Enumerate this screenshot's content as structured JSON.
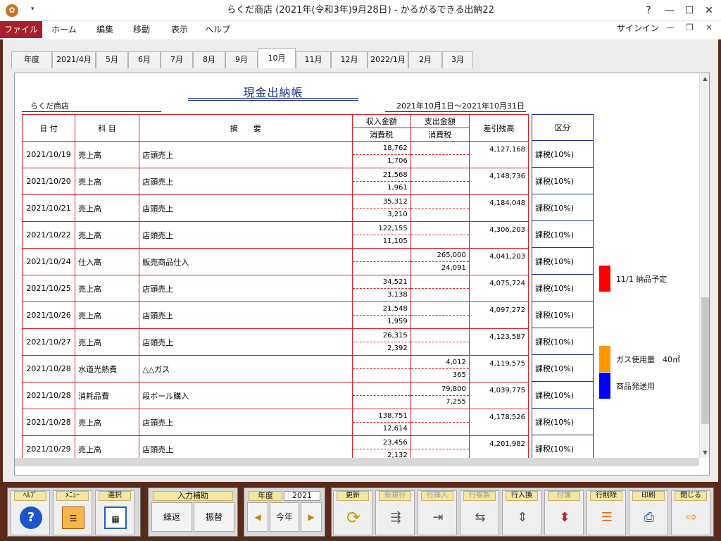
{
  "window": {
    "title": "らくだ商店 (2021年(令和3年)9月28日) - かるがるできる出納22",
    "help": "?",
    "minimize": "—",
    "maximize": "☐",
    "close": "✕"
  },
  "menu": {
    "items": [
      "ファイル",
      "ホーム",
      "編集",
      "移動",
      "表示",
      "ヘルプ"
    ],
    "signin": "サインイン"
  },
  "tabs": [
    "年度",
    "2021/4月",
    "5月",
    "6月",
    "7月",
    "8月",
    "9月",
    "10月",
    "11月",
    "12月",
    "2022/1月",
    "2月",
    "3月"
  ],
  "ledger": {
    "title": "現金出納帳",
    "company": "らくだ商店",
    "period": "2021年10月1日～2021年10月31日",
    "headers": {
      "date": "日 付",
      "subject": "科 目",
      "description": "摘　　要",
      "income": "収入金額",
      "income_tax": "消費税",
      "expense": "支出金額",
      "expense_tax": "消費税",
      "balance": "差引残高",
      "category": "区分"
    },
    "rows": [
      {
        "date": "2021/10/19",
        "subject": "売上高",
        "description": "店頭売上",
        "income": "18,762",
        "income_tax": "1,706",
        "expense": "",
        "expense_tax": "",
        "balance": "4,127,168",
        "category": "課税(10%)"
      },
      {
        "date": "2021/10/20",
        "subject": "売上高",
        "description": "店頭売上",
        "income": "21,568",
        "income_tax": "1,961",
        "expense": "",
        "expense_tax": "",
        "balance": "4,148,736",
        "category": "課税(10%)"
      },
      {
        "date": "2021/10/21",
        "subject": "売上高",
        "description": "店頭売上",
        "income": "35,312",
        "income_tax": "3,210",
        "expense": "",
        "expense_tax": "",
        "balance": "4,184,048",
        "category": "課税(10%)"
      },
      {
        "date": "2021/10/22",
        "subject": "売上高",
        "description": "店頭売上",
        "income": "122,155",
        "income_tax": "11,105",
        "expense": "",
        "expense_tax": "",
        "balance": "4,306,203",
        "category": "課税(10%)"
      },
      {
        "date": "2021/10/24",
        "subject": "仕入高",
        "description": "販売商品仕入",
        "income": "",
        "income_tax": "",
        "expense": "265,000",
        "expense_tax": "24,091",
        "balance": "4,041,203",
        "category": "課税(10%)"
      },
      {
        "date": "2021/10/25",
        "subject": "売上高",
        "description": "店頭売上",
        "income": "34,521",
        "income_tax": "3,138",
        "expense": "",
        "expense_tax": "",
        "balance": "4,075,724",
        "category": "課税(10%)"
      },
      {
        "date": "2021/10/26",
        "subject": "売上高",
        "description": "店頭売上",
        "income": "21,548",
        "income_tax": "1,959",
        "expense": "",
        "expense_tax": "",
        "balance": "4,097,272",
        "category": "課税(10%)"
      },
      {
        "date": "2021/10/27",
        "subject": "売上高",
        "description": "店頭売上",
        "income": "26,315",
        "income_tax": "2,392",
        "expense": "",
        "expense_tax": "",
        "balance": "4,123,587",
        "category": "課税(10%)"
      },
      {
        "date": "2021/10/28",
        "subject": "水道光熱費",
        "description": "△△ガス",
        "income": "",
        "income_tax": "",
        "expense": "4,012",
        "expense_tax": "365",
        "balance": "4,119,575",
        "category": "課税(10%)"
      },
      {
        "date": "2021/10/28",
        "subject": "消耗品費",
        "description": "段ボール購入",
        "income": "",
        "income_tax": "",
        "expense": "79,800",
        "expense_tax": "7,255",
        "balance": "4,039,775",
        "category": "課税(10%)"
      },
      {
        "date": "2021/10/28",
        "subject": "売上高",
        "description": "店頭売上",
        "income": "138,751",
        "income_tax": "12,614",
        "expense": "",
        "expense_tax": "",
        "balance": "4,178,526",
        "category": "課税(10%)"
      },
      {
        "date": "2021/10/29",
        "subject": "売上高",
        "description": "店頭売上",
        "income": "23,456",
        "income_tax": "2,132",
        "expense": "",
        "expense_tax": "",
        "balance": "4,201,982",
        "category": "課税(10%)"
      }
    ]
  },
  "notes": [
    {
      "text": "11/1 納品予定",
      "color": "#ff0000"
    },
    {
      "text": "ガス使用量　40㎥",
      "color": "#ff9900"
    },
    {
      "text": "商品発送用",
      "color": "#0000ff"
    }
  ],
  "toolbar": {
    "help": "ﾍﾙﾌﾟ",
    "menu": "ﾒﾆｭｰ",
    "select": "選択",
    "input_assist": "入力補助",
    "repeat": "繰返",
    "transfer": "振替",
    "year_label": "年度",
    "year_value": "2021",
    "this_year": "今年",
    "update": "更新",
    "new_row": "新規行",
    "insert_row": "行挿入",
    "copy_row": "行複製",
    "swap_row": "行入換",
    "tag": "付箋",
    "delete_row": "行削除",
    "print": "印刷",
    "close": "閉じる"
  }
}
